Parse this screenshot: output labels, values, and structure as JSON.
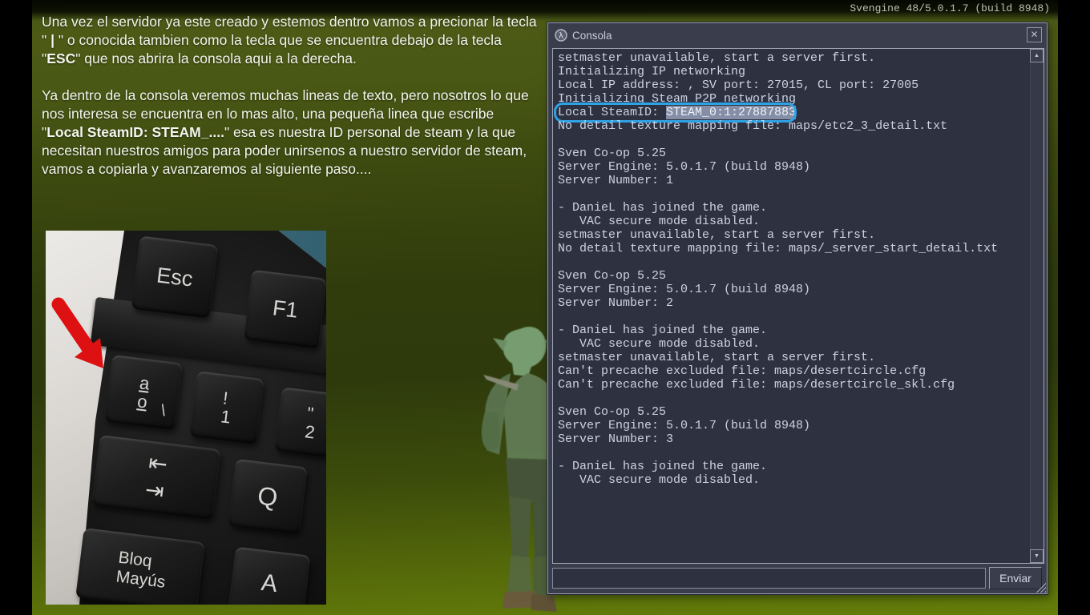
{
  "hud": {
    "engine_version": "Svengine 48/5.0.1.7 (build 8948)"
  },
  "tutorial": {
    "paragraph1": [
      {
        "t": "Una vez el servidor ya este creado y estemos dentro vamos a precionar la tecla \" ",
        "b": false
      },
      {
        "t": "|",
        "b": true
      },
      {
        "t": " \" o conocida tambien como la tecla que se encuentra debajo de la tecla \"",
        "b": false
      },
      {
        "t": "ESC",
        "b": true
      },
      {
        "t": "\" que nos abrira la consola aqui a la derecha.",
        "b": false
      }
    ],
    "paragraph2": [
      {
        "t": "Ya dentro de la consola veremos muchas lineas de texto, pero nosotros lo que nos interesa se encuentra en lo mas alto, una pequeña linea que escribe \"",
        "b": false
      },
      {
        "t": "Local SteamID: STEAM_....",
        "b": true
      },
      {
        "t": "\" esa es nuestra ID personal de steam y la que necesitan nuestros amigos para poder unirsenos a nuestro servidor de steam, vamos a copiarla y avanzaremos al siguiente paso....",
        "b": false
      }
    ]
  },
  "keyboard_photo": {
    "keys": {
      "esc": "Esc",
      "f1": "F1",
      "ord_a": "a",
      "ord_o": "o",
      "ord_slash": "\\",
      "one_shift": "!",
      "one": "1",
      "two_shift": "\"",
      "two": "2",
      "tab_back": "⇤",
      "tab_fwd": "⇥",
      "q": "Q",
      "caps_line1": "Bloq",
      "caps_line2": "Mayús",
      "a": "A"
    }
  },
  "console": {
    "title": "Consola",
    "send_button": "Enviar",
    "input_value": "",
    "lines": [
      {
        "t": "setmaster unavailable, start a server first."
      },
      {
        "t": "Initializing IP networking"
      },
      {
        "t": "Local IP address: , SV port: 27015, CL port: 27005"
      },
      {
        "t": "Initializing Steam P2P networking"
      },
      {
        "pre": "Local SteamID: ",
        "sel": "STEAM_0:1:27887883",
        "hl": true
      },
      {
        "t": "No detail texture mapping file: maps/etc2_3_detail.txt"
      },
      {
        "t": ""
      },
      {
        "t": "Sven Co-op 5.25"
      },
      {
        "t": "Server Engine: 5.0.1.7 (build 8948)"
      },
      {
        "t": "Server Number: 1"
      },
      {
        "t": ""
      },
      {
        "t": "- DanieL has joined the game."
      },
      {
        "t": "   VAC secure mode disabled."
      },
      {
        "t": "setmaster unavailable, start a server first."
      },
      {
        "t": "No detail texture mapping file: maps/_server_start_detail.txt"
      },
      {
        "t": ""
      },
      {
        "t": "Sven Co-op 5.25"
      },
      {
        "t": "Server Engine: 5.0.1.7 (build 8948)"
      },
      {
        "t": "Server Number: 2"
      },
      {
        "t": ""
      },
      {
        "t": "- DanieL has joined the game."
      },
      {
        "t": "   VAC secure mode disabled."
      },
      {
        "t": "setmaster unavailable, start a server first."
      },
      {
        "t": "Can't precache excluded file: maps/desertcircle.cfg"
      },
      {
        "t": "Can't precache excluded file: maps/desertcircle_skl.cfg"
      },
      {
        "t": ""
      },
      {
        "t": "Sven Co-op 5.25"
      },
      {
        "t": "Server Engine: 5.0.1.7 (build 8948)"
      },
      {
        "t": "Server Number: 3"
      },
      {
        "t": ""
      },
      {
        "t": "- DanieL has joined the game."
      },
      {
        "t": "   VAC secure mode disabled."
      }
    ]
  },
  "icons": {
    "lambda": "λ",
    "close": "✕",
    "scroll_up": "▲",
    "scroll_down": "▼"
  },
  "colors": {
    "background_olive": "#3c490f",
    "console_bg": "#3a3d4b",
    "console_output_bg": "#2e3140",
    "console_text": "#ccd2e2",
    "selection_bg": "#848ea6",
    "highlight_ring": "#2da3e6",
    "arrow_red": "#dd1111"
  }
}
